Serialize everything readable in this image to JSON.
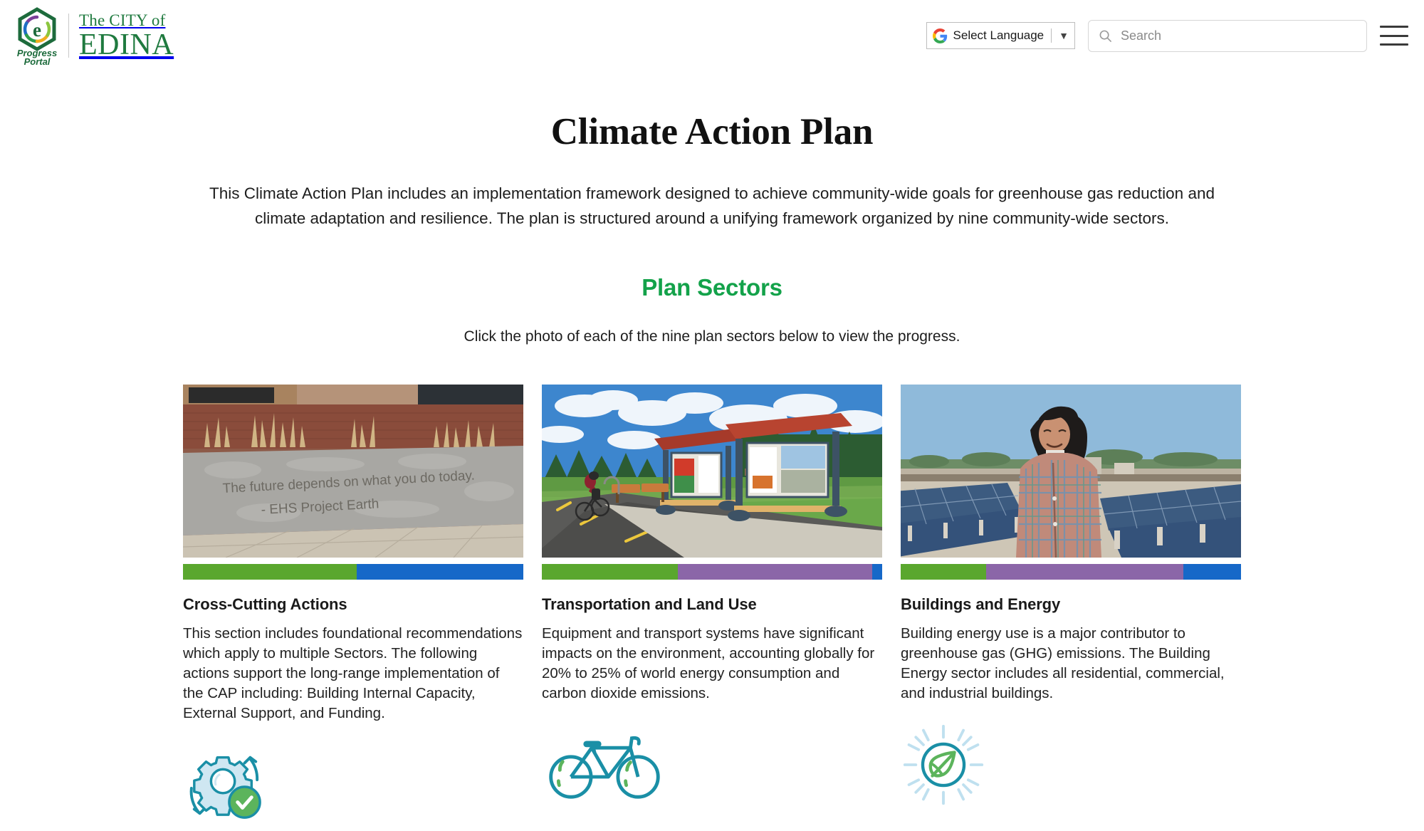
{
  "header": {
    "logo": {
      "mark_label": "progress-portal-hex-logo",
      "mark_caption_line1": "Progress",
      "mark_caption_line2": "Portal",
      "wordmark_line1": "The CITY of",
      "wordmark_line2": "EDINA"
    },
    "language_widget": {
      "icon": "google-g-icon",
      "label": "Select Language",
      "caret": "▼"
    },
    "search": {
      "icon": "search-icon",
      "placeholder": "Search",
      "value": ""
    },
    "menu_button": "hamburger-menu-icon"
  },
  "main": {
    "page_title": "Climate Action Plan",
    "intro": "This Climate Action Plan includes an implementation framework designed to achieve community-wide goals for greenhouse gas reduction and climate adaptation and resilience. The plan is structured around a unifying framework organized by nine community-wide sectors.",
    "section_title": "Plan Sectors",
    "section_subtitle": "Click the photo of each of the nine plan sectors  below to view the progress."
  },
  "colors": {
    "accent_green": "#13a24a",
    "brand_green": "#1f7a3f",
    "bar_green": "#5aa72e",
    "bar_purple": "#8b66a8",
    "bar_blue": "#1668c8",
    "icon_teal": "#1a8fa6",
    "icon_light_blue": "#b6dcec",
    "icon_green": "#5cb45c"
  },
  "cards": [
    {
      "title": "Cross-Cutting Actions",
      "body": "This section includes foundational recommendations which apply to multiple Sectors. The following actions support the long-range implementation of the CAP including: Building Internal Capacity, External Support, and Funding.",
      "photo_name": "concrete-wall-quote-photo",
      "photo_alt_text": "The future depends on what you do today. - EHS Project Earth",
      "icon_name": "gear-refresh-check-icon",
      "progress": [
        {
          "label": "green",
          "color": "#5aa72e",
          "percent": 51
        },
        {
          "label": "blue",
          "color": "#1668c8",
          "percent": 49
        }
      ]
    },
    {
      "title": "Transportation and Land Use",
      "body": "Equipment and transport systems have significant impacts on the environment, accounting globally for 20% to 25% of world energy consumption and carbon dioxide emissions.",
      "photo_name": "bike-trail-kiosk-photo",
      "photo_alt_text": "Cyclist riding a paved trail beside two trailhead kiosks with red roofs",
      "icon_name": "bicycle-icon",
      "progress": [
        {
          "label": "green",
          "color": "#5aa72e",
          "percent": 40
        },
        {
          "label": "purple",
          "color": "#8b66a8",
          "percent": 57
        },
        {
          "label": "blue",
          "color": "#1668c8",
          "percent": 3
        }
      ]
    },
    {
      "title": "Buildings and Energy",
      "body": "Building energy use is a major contributor to greenhouse gas (GHG) emissions. The Building Energy sector includes all residential, commercial, and industrial buildings.",
      "photo_name": "rooftop-solar-panels-photo",
      "photo_alt_text": "Person standing on a rooftop among solar panel arrays",
      "icon_name": "sun-leaf-icon",
      "progress": [
        {
          "label": "green",
          "color": "#5aa72e",
          "percent": 25
        },
        {
          "label": "purple",
          "color": "#8b66a8",
          "percent": 58
        },
        {
          "label": "blue",
          "color": "#1668c8",
          "percent": 17
        }
      ]
    }
  ]
}
